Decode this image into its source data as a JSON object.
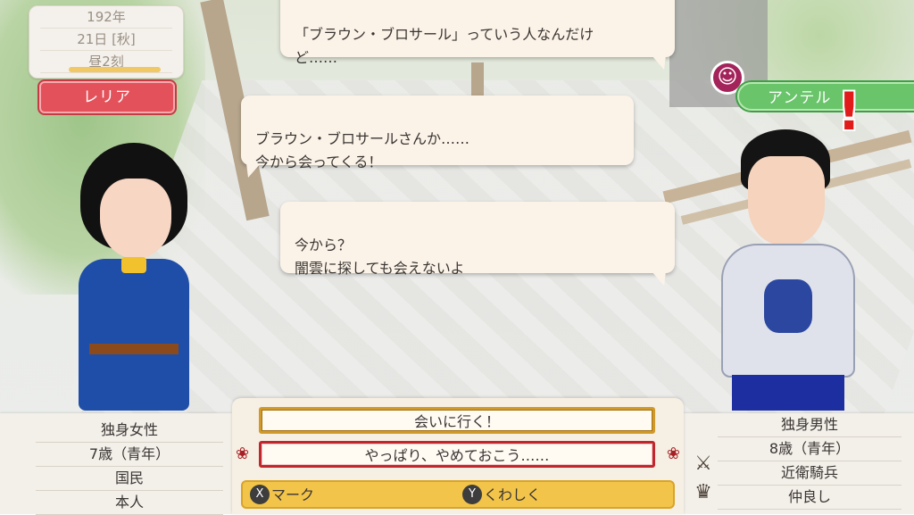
{
  "date": {
    "year": "192年",
    "day": "21日 [秋]",
    "time": "昼2刻",
    "time_progress": 0.83
  },
  "characters": {
    "left": {
      "name": "レリア"
    },
    "right": {
      "name": "アンテル"
    }
  },
  "dialogue": [
    {
      "text": "「ブラウン・ブロサール」っていう人なんだけ\nど……"
    },
    {
      "text": "ブラウン・ブロサールさんか……\n今から会ってくる！"
    },
    {
      "text": "今から？\n闇雲に探しても会えないよ"
    }
  ],
  "choices": [
    {
      "label": "会いに行く！"
    },
    {
      "label": "やっぱり、やめておこう……"
    }
  ],
  "buttons": {
    "x_key": "X",
    "x_label": "マーク",
    "y_key": "Y",
    "y_label": "くわしく"
  },
  "left_info": [
    "独身女性",
    "7歳（青年）",
    "国民",
    "本人"
  ],
  "right_info": [
    "独身男性",
    "8歳（青年）",
    "近衛騎兵",
    "仲良し"
  ],
  "colors": {
    "left_plate": "#e3525a",
    "right_plate": "#69c46a",
    "alert": "#e11a1a"
  }
}
